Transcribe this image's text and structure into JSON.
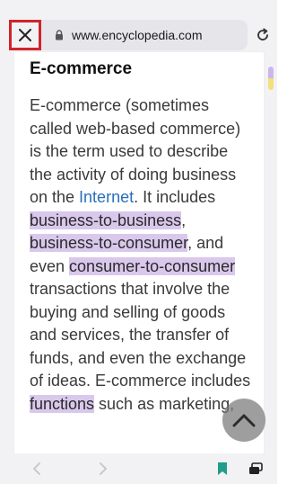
{
  "toolbar": {
    "url": "www.encyclopedia.com"
  },
  "article": {
    "title": "E-commerce",
    "lines": [
      [
        {
          "t": "E-commerce (sometimes"
        }
      ],
      [
        {
          "t": "called web-based commerce)"
        }
      ],
      [
        {
          "t": "is the term used to describe"
        }
      ],
      [
        {
          "t": "the activity of doing business"
        }
      ],
      [
        {
          "t": "on the "
        },
        {
          "t": "Internet",
          "style": "link"
        },
        {
          "t": ". It includes"
        }
      ],
      [
        {
          "t": "business-to-business",
          "style": "hl"
        },
        {
          "t": ","
        }
      ],
      [
        {
          "t": "business-to-consumer",
          "style": "hl"
        },
        {
          "t": ", and"
        }
      ],
      [
        {
          "t": "even "
        },
        {
          "t": "consumer-to-consumer",
          "style": "hl"
        }
      ],
      [
        {
          "t": "transactions that involve the"
        }
      ],
      [
        {
          "t": "buying and selling of goods"
        }
      ],
      [
        {
          "t": "and services, the transfer of"
        }
      ],
      [
        {
          "t": "funds, and even the exchange"
        }
      ],
      [
        {
          "t": "of ideas. E-commerce includes"
        }
      ],
      [
        {
          "t": "functions",
          "style": "hl"
        },
        {
          "t": " such as marketing,"
        }
      ]
    ]
  },
  "colors": {
    "highlight": "#d9c8ec",
    "link": "#2a6ebb",
    "close_border": "#d0242b",
    "bookmark": "#1f9e8a"
  },
  "icons": {
    "close": "close-icon",
    "lock": "lock-icon",
    "reload": "reload-icon",
    "scroll_top": "chevron-up-icon",
    "back": "chevron-left-icon",
    "forward": "chevron-right-icon",
    "bookmark": "bookmark-icon",
    "tabs": "tabs-icon"
  }
}
